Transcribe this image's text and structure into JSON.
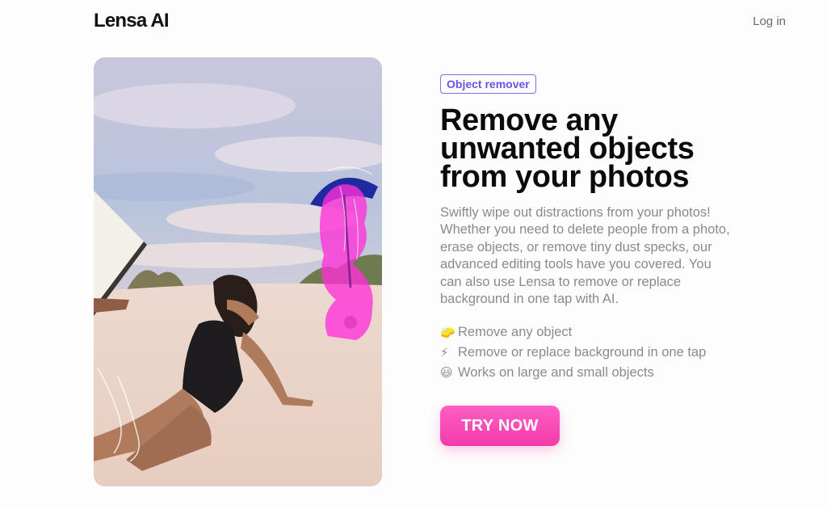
{
  "header": {
    "logo": "Lensa AI",
    "login_label": "Log in"
  },
  "hero": {
    "badge": "Object remover",
    "headline": "Remove any unwanted objects from your photos",
    "description": "Swiftly wipe out distractions from your photos! Whether you need to delete people from a photo, erase objects, or remove tiny dust specks, our advanced editing tools have you covered. You can also use Lensa to remove or replace background in one tap with AI.",
    "features": [
      {
        "icon": "eraser-icon",
        "emoji": "🧽",
        "label": "Remove any object"
      },
      {
        "icon": "lightning-icon",
        "emoji": "⚡",
        "label": "Remove or replace background in one tap"
      },
      {
        "icon": "smiley-icon",
        "emoji": "😃",
        "label": "Works on large and small objects"
      }
    ],
    "cta_label": "TRY NOW"
  },
  "colors": {
    "accent": "#f23ba8",
    "badge": "#6355e8",
    "highlight": "#ff2fd8"
  }
}
